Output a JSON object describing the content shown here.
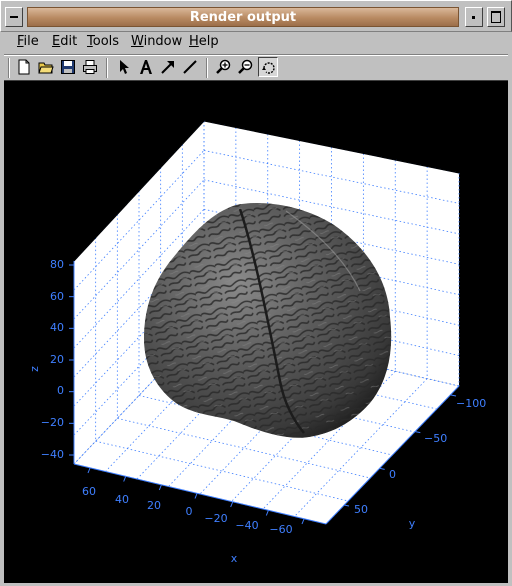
{
  "window": {
    "title": "Render output",
    "colors": {
      "titlebar": "#b88a62",
      "chrome": "#c0c0c0",
      "plot_bg": "#000000",
      "axis": "#3f7fff",
      "surface": "#5a5a5a"
    }
  },
  "menubar": {
    "items": [
      "File",
      "Edit",
      "Tools",
      "Window",
      "Help"
    ]
  },
  "toolbar": {
    "buttons": [
      {
        "name": "new-file-icon"
      },
      {
        "name": "open-folder-icon"
      },
      {
        "name": "save-icon"
      },
      {
        "name": "print-icon"
      },
      {
        "name": "select-arrow-icon"
      },
      {
        "name": "insert-text-icon"
      },
      {
        "name": "insert-arrow-icon"
      },
      {
        "name": "insert-line-icon"
      },
      {
        "name": "zoom-in-icon"
      },
      {
        "name": "zoom-out-icon"
      },
      {
        "name": "rotate-3d-icon",
        "pressed": true
      }
    ]
  },
  "plot": {
    "surface": "brain",
    "z_axis": {
      "label": "z",
      "ticks": [
        "80",
        "60",
        "40",
        "20",
        "0",
        "−20",
        "−40"
      ]
    },
    "x_axis": {
      "label": "x",
      "ticks": [
        "60",
        "40",
        "20",
        "0",
        "−20",
        "−40",
        "−60"
      ]
    },
    "y_axis": {
      "label": "y",
      "ticks": [
        "−100",
        "−50",
        "0",
        "50"
      ]
    }
  }
}
